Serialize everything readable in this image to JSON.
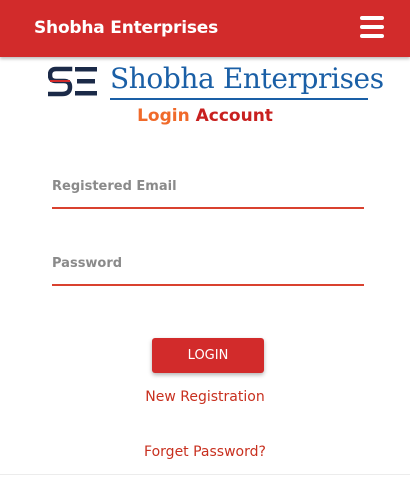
{
  "header": {
    "brand": "Shobha Enterprises",
    "menu_icon": "hamburger-menu-icon",
    "background_color": "#d22b2b"
  },
  "logo": {
    "monogram": "SE",
    "text": "Shobha Enterprises",
    "text_color": "#1a5fa6"
  },
  "heading": {
    "login_word": "Login",
    "account_word": "Account",
    "login_color": "#f06a2a",
    "account_color": "#c8201f"
  },
  "form": {
    "email_placeholder": "Registered Email",
    "email_value": "",
    "password_placeholder": "Password",
    "password_value": "",
    "login_button": "LOGIN",
    "accent_color": "#d9412f"
  },
  "links": {
    "new_registration": "New Registration",
    "forget_password": "Forget Password?"
  }
}
